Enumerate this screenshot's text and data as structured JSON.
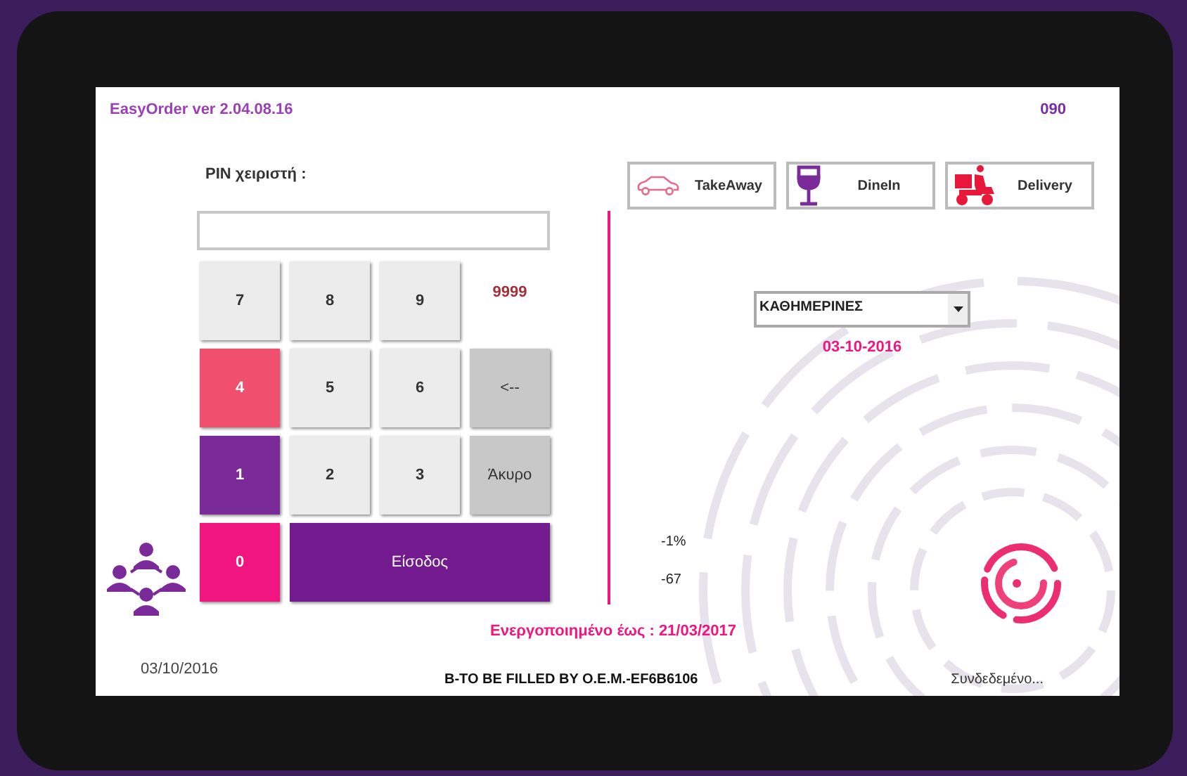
{
  "app": {
    "title": "EasyOrder ver 2.04.08.16",
    "terminal": "090"
  },
  "login": {
    "pin_label": "PIN χειριστή :",
    "code_hint": "9999",
    "keypad": [
      [
        {
          "label": "7",
          "kind": "plain",
          "color": "#ececec"
        },
        {
          "label": "8",
          "kind": "plain",
          "color": "#ececec"
        },
        {
          "label": "9",
          "kind": "plain",
          "color": "#ececec"
        }
      ],
      [
        {
          "label": "4",
          "kind": "accent",
          "color": "#f0506e"
        },
        {
          "label": "5",
          "kind": "plain",
          "color": "#ececec"
        },
        {
          "label": "6",
          "kind": "plain",
          "color": "#ececec"
        },
        {
          "label": "<--",
          "kind": "action",
          "color": "#c8c8c8"
        }
      ],
      [
        {
          "label": "1",
          "kind": "accent",
          "color": "#7b2a9a"
        },
        {
          "label": "2",
          "kind": "plain",
          "color": "#ececec"
        },
        {
          "label": "3",
          "kind": "plain",
          "color": "#ececec"
        },
        {
          "label": "Άκυρο",
          "kind": "action",
          "color": "#c8c8c8"
        }
      ],
      [
        {
          "label": "0",
          "kind": "accent",
          "color": "#f0157f"
        },
        {
          "label": "Είσοδος",
          "kind": "enter",
          "color": "#731b8e"
        }
      ]
    ]
  },
  "order_types": [
    {
      "label": "TakeAway",
      "kind": "car"
    },
    {
      "label": "DineIn",
      "kind": "glass"
    },
    {
      "label": "Delivery",
      "kind": "scooter"
    }
  ],
  "menu_select": {
    "value": "ΚΑΘΗΜΕΡΙΝΕΣ"
  },
  "menu_date": "03-10-2016",
  "stats": [
    "-1%",
    "-67"
  ],
  "activation": "Ενεργοποιημένο έως : 21/03/2017",
  "footer": {
    "date": "03/10/2016",
    "serial": "B-TO BE FILLED BY O.E.M.-EF6B6106",
    "connection": "Συνδεδεμένο..."
  }
}
